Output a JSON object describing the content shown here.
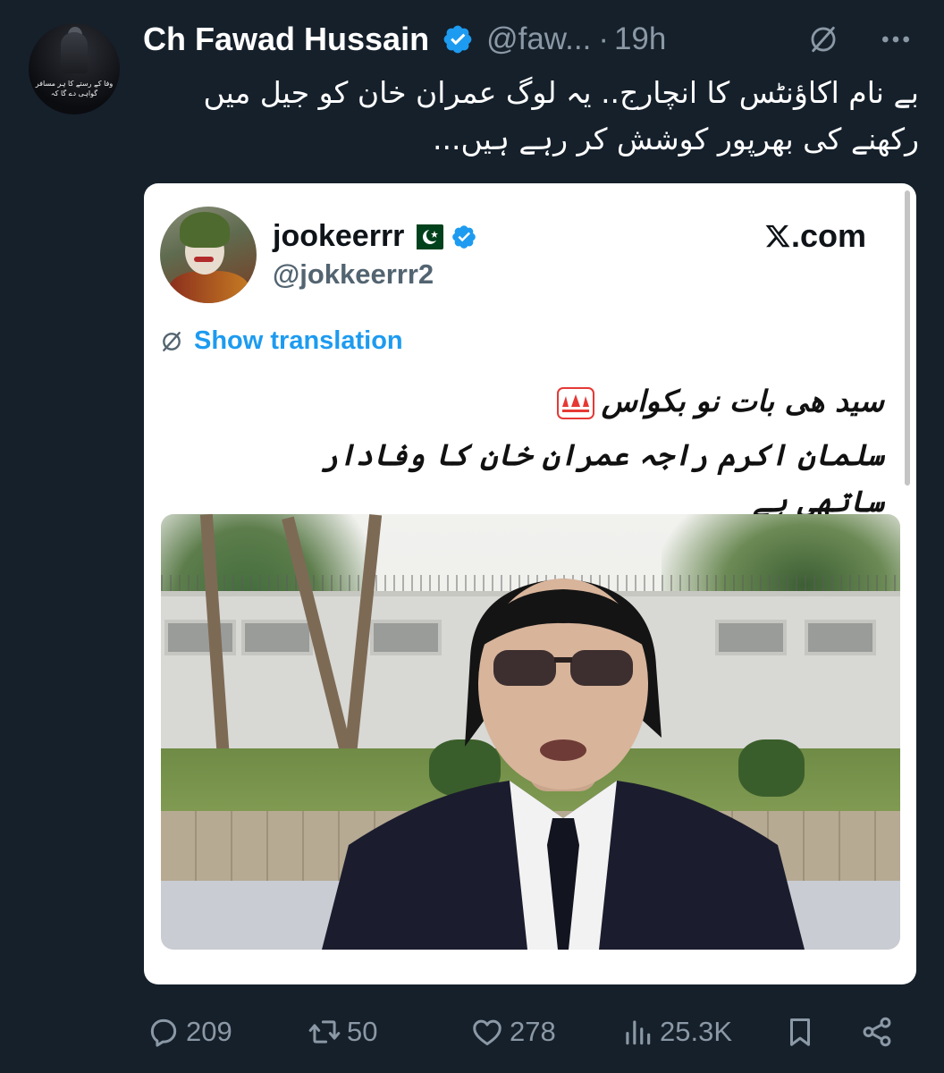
{
  "author": {
    "display_name": "Ch Fawad Hussain",
    "handle": "@faw...",
    "separator": "·",
    "time_ago": "19h",
    "avatar_caption": "وفا کے رستے کا ہر مسافر گواہی دے گا کہ"
  },
  "tweet": {
    "text": "بے نام اکاؤنٹس کا انچارج.. یہ لوگ عمران خان کو جیل میں رکھنے کی بھرپور کوشش کر رہے ہیں..."
  },
  "quote": {
    "display_name": "jookeerrr",
    "handle": "@jokkeerrr2",
    "source_label": ".com",
    "translate_label": "Show translation",
    "text_line_1": "سید ھی بات نو بکواس",
    "text_line_2": "سلمان اکرم راجہ عمران خان کا وفادار ساتھی ہے"
  },
  "actions": {
    "replies": "209",
    "reposts": "50",
    "likes": "278",
    "views": "25.3K"
  },
  "colors": {
    "background": "#15202b",
    "muted": "#8b98a5",
    "verified": "#1d9bf0",
    "link": "#1d9bf0",
    "card": "#ffffff"
  },
  "icons": [
    "verified-badge-icon",
    "grok-icon",
    "more-options-icon",
    "pakistan-flag-icon",
    "x-logo-icon",
    "translate-icon",
    "hundred-points-emoji-icon",
    "reply-icon",
    "repost-icon",
    "like-icon",
    "views-icon",
    "bookmark-icon",
    "share-icon"
  ]
}
